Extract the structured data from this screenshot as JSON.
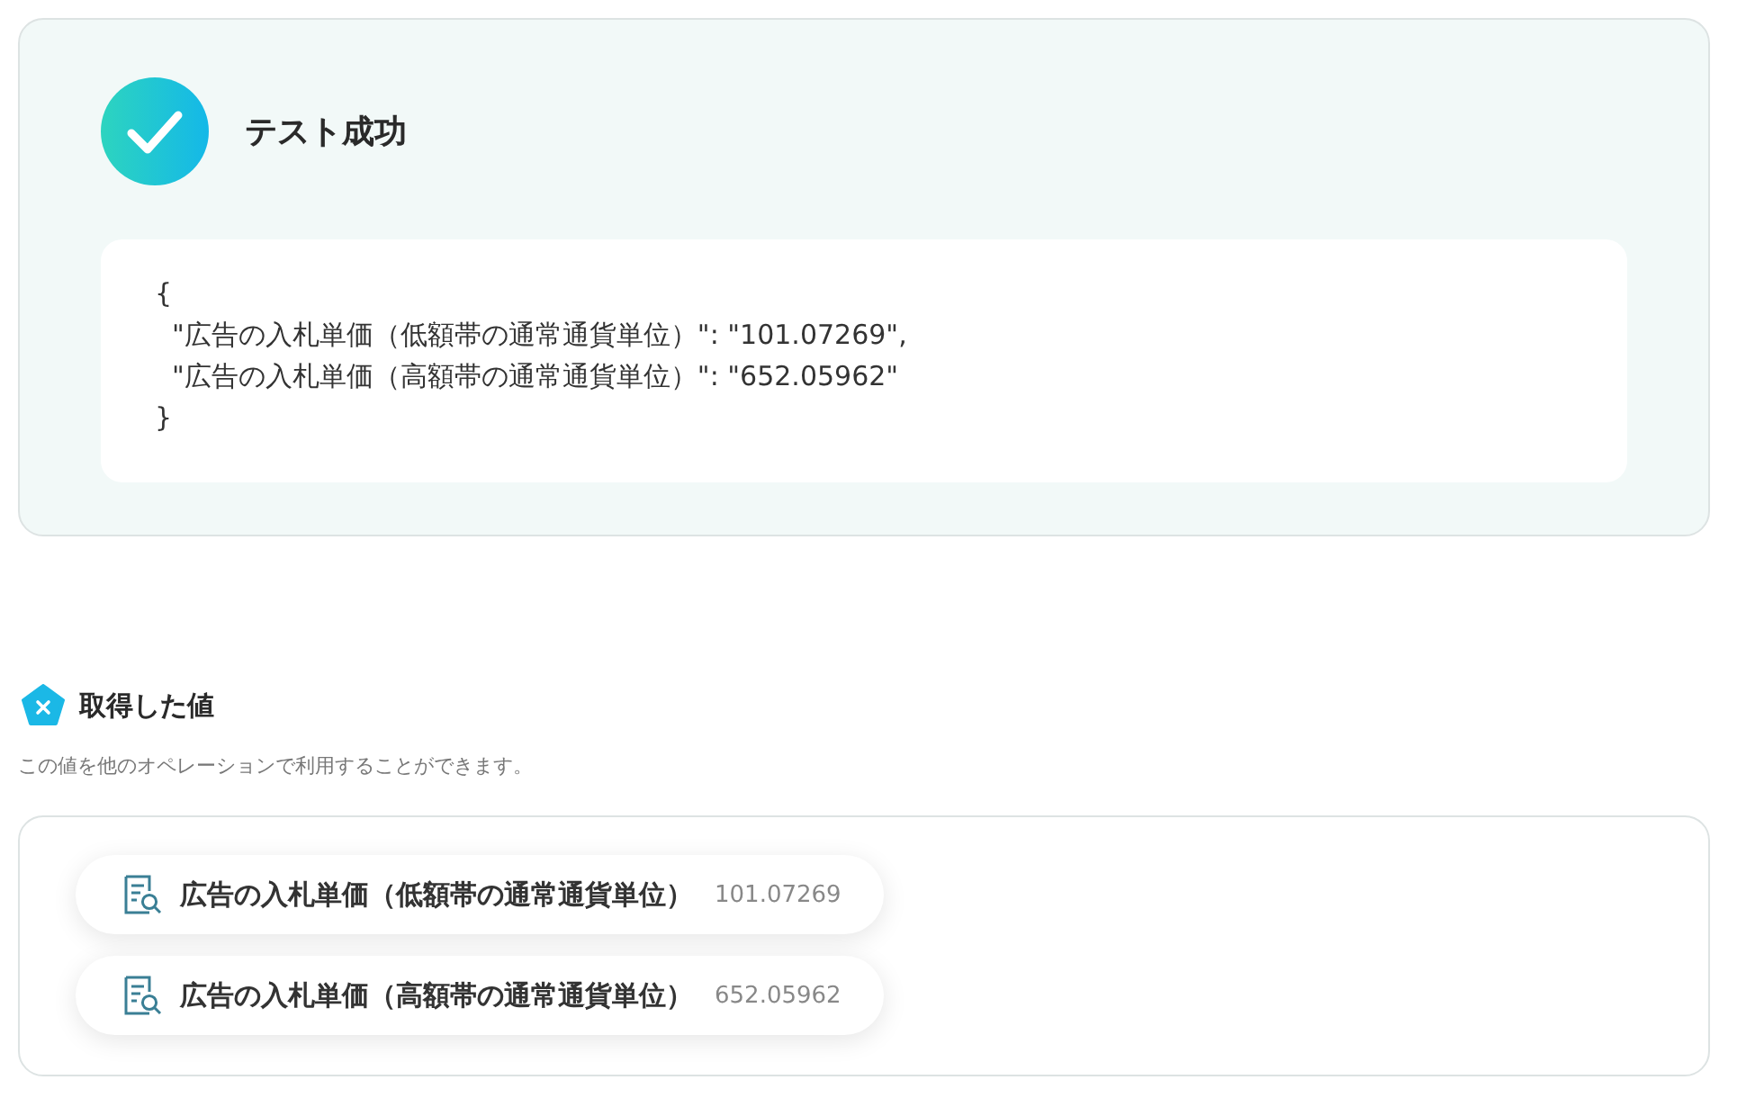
{
  "test_result": {
    "title": "テスト成功",
    "code_lines": [
      "{",
      "  \"広告の入札単価（低額帯の通常通貨単位）\": \"101.07269\",",
      "  \"広告の入札単価（高額帯の通常通貨単位）\": \"652.05962\"",
      "}"
    ]
  },
  "retrieved_values": {
    "title": "取得した値",
    "description": "この値を他のオペレーションで利用することができます。",
    "items": [
      {
        "label": "広告の入札単価（低額帯の通常通貨単位）",
        "value": "101.07269"
      },
      {
        "label": "広告の入札単価（高額帯の通常通貨単位）",
        "value": "652.05962"
      }
    ]
  }
}
